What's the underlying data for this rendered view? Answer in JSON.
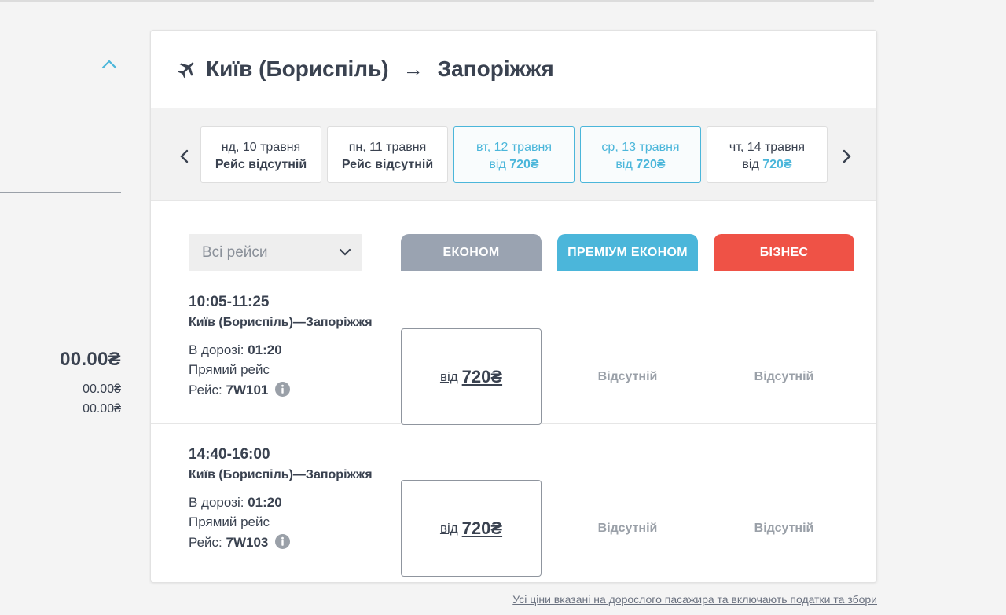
{
  "sidebar": {
    "total": "00.00₴",
    "sub1": "00.00₴",
    "sub2": "00.00₴"
  },
  "header": {
    "origin": "Київ (Бориспіль)",
    "arrow": "→",
    "destination": "Запоріжжя"
  },
  "dates": [
    {
      "date": "нд, 10 травня",
      "info": "Рейс відсутній",
      "from": "",
      "price": ""
    },
    {
      "date": "пн, 11 травня",
      "info": "Рейс відсутній",
      "from": "",
      "price": ""
    },
    {
      "date": "вт, 12 травня",
      "info": "",
      "from": "від",
      "price": "720₴"
    },
    {
      "date": "ср, 13 травня",
      "info": "",
      "from": "від",
      "price": "720₴"
    },
    {
      "date": "чт, 14 травня",
      "info": "",
      "from": "від",
      "price": "720₴"
    }
  ],
  "filter": {
    "label": "Всі рейси"
  },
  "classes": {
    "economy": "ЕКОНОМ",
    "premium": "ПРЕМІУМ ЕКОНОМ",
    "business": "БІЗНЕС"
  },
  "flights": [
    {
      "time": "10:05-11:25",
      "route": "Київ (Бориспіль)—Запоріжжя",
      "duration_label": "В дорозі:",
      "duration": "01:20",
      "type": "Прямий рейс",
      "flight_label": "Рейс:",
      "flight_no": "7W101",
      "economy_from": "від",
      "economy_price": "720₴",
      "premium": "Відсутній",
      "business": "Відсутній"
    },
    {
      "time": "14:40-16:00",
      "route": "Київ (Бориспіль)—Запоріжжя",
      "duration_label": "В дорозі:",
      "duration": "01:20",
      "type": "Прямий рейс",
      "flight_label": "Рейс:",
      "flight_no": "7W103",
      "economy_from": "від",
      "economy_price": "720₴",
      "premium": "Відсутній",
      "business": "Відсутній"
    }
  ],
  "footnote": "Усі ціни вказані на дорослого пасажира та включають податки та збори",
  "colors": {
    "accent": "#4bb6da",
    "economy": "#9aa3b1",
    "business": "#ef5246",
    "text": "#3a4250"
  }
}
